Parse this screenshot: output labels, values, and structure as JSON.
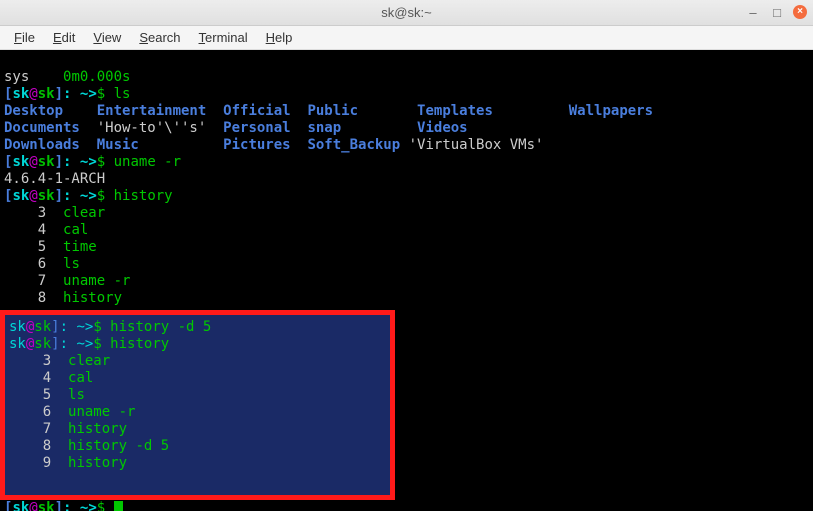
{
  "window": {
    "title": "sk@sk:~"
  },
  "menu": {
    "file": "File",
    "edit": "Edit",
    "view": "View",
    "search": "Search",
    "terminal": "Terminal",
    "help": "Help"
  },
  "term": {
    "sys_label": "sys",
    "sys_time": "0m0.000s",
    "prompt_open": "[",
    "prompt_user": "sk",
    "prompt_at": "@",
    "prompt_host": "sk",
    "prompt_close": "]",
    "prompt_path": ": ~>",
    "prompt_sym": "$ ",
    "cmd_ls": "ls",
    "ls_row1_c1": "Desktop    ",
    "ls_row1_c2": "Entertainment  ",
    "ls_row1_c3": "Official  ",
    "ls_row1_c4": "Public       ",
    "ls_row1_c5": "Templates         ",
    "ls_row1_c6": "Wallpapers",
    "ls_row2_c1": "Documents  ",
    "ls_row2_c2": "'How-to'\\''s'",
    "ls_row2_c3": "  Personal  ",
    "ls_row2_c4": "snap",
    "ls_row2_c5": "         Videos",
    "ls_row3_c1": "Downloads  ",
    "ls_row3_c2": "Music          ",
    "ls_row3_c3": "Pictures  ",
    "ls_row3_c4": "Soft_Backup",
    "ls_row3_c5": " 'VirtualBox VMs'",
    "cmd_uname": "uname -r",
    "uname_out": "4.6.4-1-ARCH",
    "cmd_history": "history",
    "hist1_n": "    3  ",
    "hist1_c": "clear",
    "hist2_n": "    4  ",
    "hist2_c": "cal",
    "hist3_n": "    5  ",
    "hist3_c": "time",
    "hist4_n": "    6  ",
    "hist4_c": "ls",
    "hist5_n": "    7  ",
    "hist5_c": "uname -r",
    "hist6_n": "    8  ",
    "hist6_c": "history",
    "box_user": "sk",
    "box_at": "@",
    "box_host": "sk",
    "box_close": "]",
    "box_path": ": ~>",
    "box_sym": "$ ",
    "box_cmd1": "history -d 5",
    "box_cmd2": "history",
    "box_h1_n": "    3  ",
    "box_h1_c": "clear",
    "box_h2_n": "    4  ",
    "box_h2_c": "cal",
    "box_h3_n": "    5  ",
    "box_h3_c": "ls",
    "box_h4_n": "    6  ",
    "box_h4_c": "uname -r",
    "box_h5_n": "    7  ",
    "box_h5_c": "history",
    "box_h6_n": "    8  ",
    "box_h6_c": "history -d 5",
    "box_h7_n": "    9  ",
    "box_h7_c": "history"
  }
}
